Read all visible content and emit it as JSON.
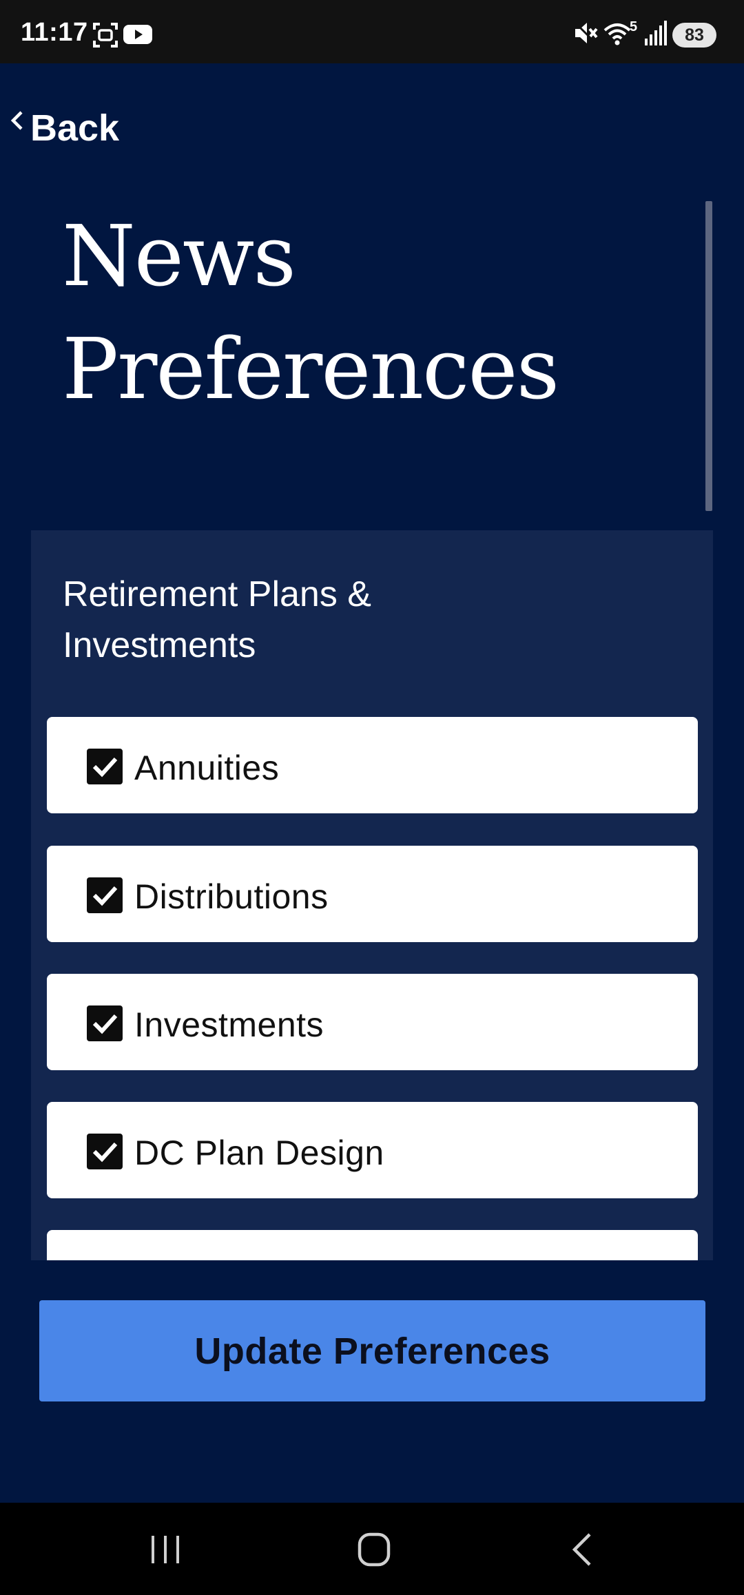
{
  "status_bar": {
    "time": "11:17",
    "left_icons": [
      "screenshot-icon",
      "youtube-icon"
    ],
    "right_icons": [
      "mute-icon",
      "wifi-icon",
      "signal-icon"
    ],
    "wifi_label": "5",
    "battery": "83"
  },
  "header": {
    "back_label": "Back",
    "title": "News Preferences"
  },
  "section": {
    "heading": "Retirement Plans & Investments",
    "options": [
      {
        "label": "Annuities",
        "checked": true
      },
      {
        "label": "Distributions",
        "checked": true
      },
      {
        "label": "Investments",
        "checked": true
      },
      {
        "label": "DC Plan Design",
        "checked": true
      },
      {
        "label": "",
        "checked": true
      }
    ]
  },
  "actions": {
    "update_label": "Update Preferences"
  },
  "nav_bar": {
    "buttons": [
      "recents-icon",
      "home-icon",
      "back-icon"
    ]
  },
  "colors": {
    "background": "#011640",
    "panel": "#13264f",
    "button": "#4a86e8",
    "card": "#ffffff"
  }
}
